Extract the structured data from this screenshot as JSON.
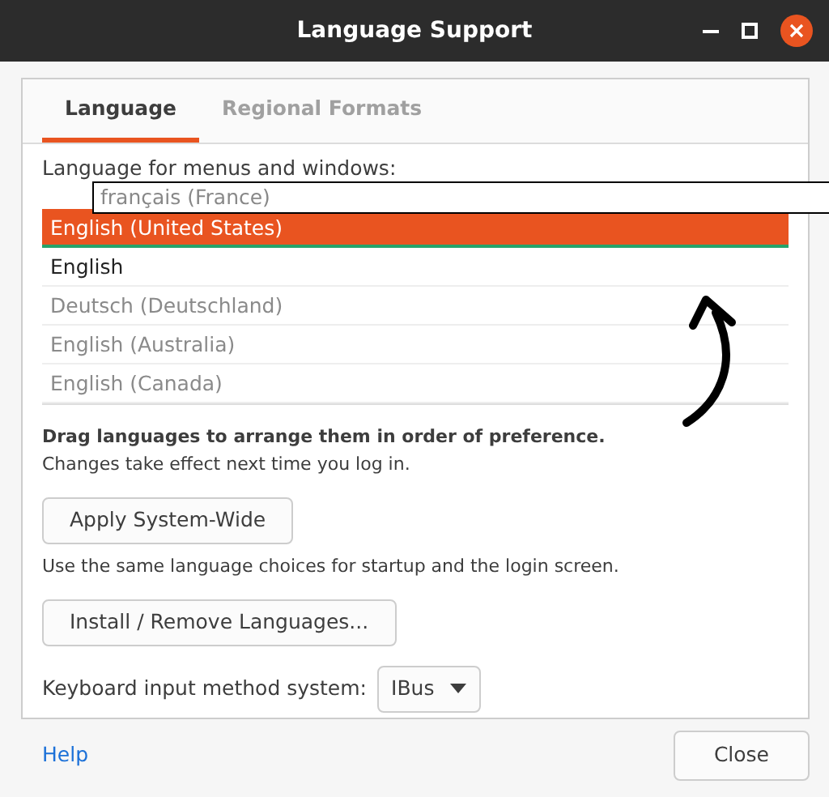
{
  "window": {
    "title": "Language Support"
  },
  "tabs": [
    {
      "label": "Language",
      "selected": true
    },
    {
      "label": "Regional Formats",
      "selected": false
    }
  ],
  "languages_label": "Language for menus and windows:",
  "languages": [
    {
      "name": "English (United States)",
      "selected": true,
      "greyed": false,
      "drop_target": true
    },
    {
      "name": "English",
      "selected": false,
      "greyed": false,
      "drop_target": false
    },
    {
      "name": "Deutsch (Deutschland)",
      "selected": false,
      "greyed": true,
      "drop_target": false
    },
    {
      "name": "English (Australia)",
      "selected": false,
      "greyed": true,
      "drop_target": false
    },
    {
      "name": "English (Canada)",
      "selected": false,
      "greyed": true,
      "drop_target": false
    }
  ],
  "drag_item": {
    "name": "français (France)"
  },
  "hint_bold": "Drag languages to arrange them in order of preference.",
  "hint": "Changes take effect next time you log in.",
  "apply_button": "Apply System-Wide",
  "apply_hint": "Use the same language choices for startup and the login screen.",
  "install_button": "Install / Remove Languages...",
  "input_method": {
    "label": "Keyboard input method system:",
    "value": "IBus"
  },
  "footer": {
    "help": "Help",
    "close": "Close"
  }
}
